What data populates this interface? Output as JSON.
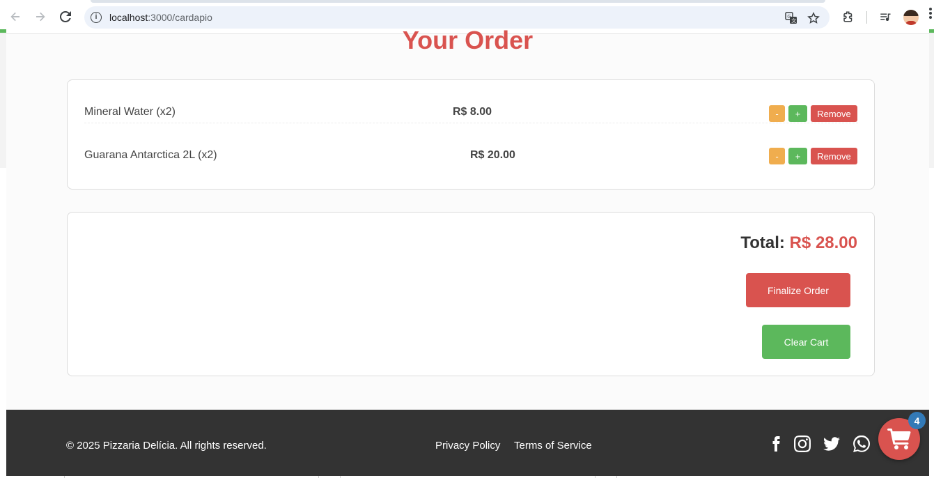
{
  "browser": {
    "url_host": "localhost",
    "url_path": ":3000/cardapio",
    "back_icon": "arrow-left-icon",
    "forward_icon": "arrow-right-icon",
    "reload_icon": "reload-icon",
    "info_icon_glyph": "i"
  },
  "page": {
    "title": "Your Order"
  },
  "cart": {
    "items": [
      {
        "name": "Mineral Water (x2)",
        "price": "R$ 8.00",
        "minus": "-",
        "plus": "+",
        "remove": "Remove"
      },
      {
        "name": "Guarana Antarctica 2L (x2)",
        "price": "R$ 20.00",
        "minus": "-",
        "plus": "+",
        "remove": "Remove"
      }
    ]
  },
  "summary": {
    "total_label": "Total:",
    "total_value": "R$ 28.00",
    "finalize_label": "Finalize Order",
    "clear_label": "Clear Cart"
  },
  "footer": {
    "copyright": "© 2025 Pizzaria Delícia. All rights reserved.",
    "links": [
      "Privacy Policy",
      "Terms of Service"
    ],
    "social_icons": [
      "facebook-icon",
      "instagram-icon",
      "twitter-icon",
      "whatsapp-icon"
    ]
  },
  "cart_fab": {
    "badge_count": "4",
    "icon": "shopping-cart-icon"
  },
  "colors": {
    "brand_red": "#d9534f",
    "success_green": "#5cb85c",
    "warning_orange": "#f0ad4e",
    "badge_blue": "#337ab7",
    "footer_bg": "#333333"
  }
}
